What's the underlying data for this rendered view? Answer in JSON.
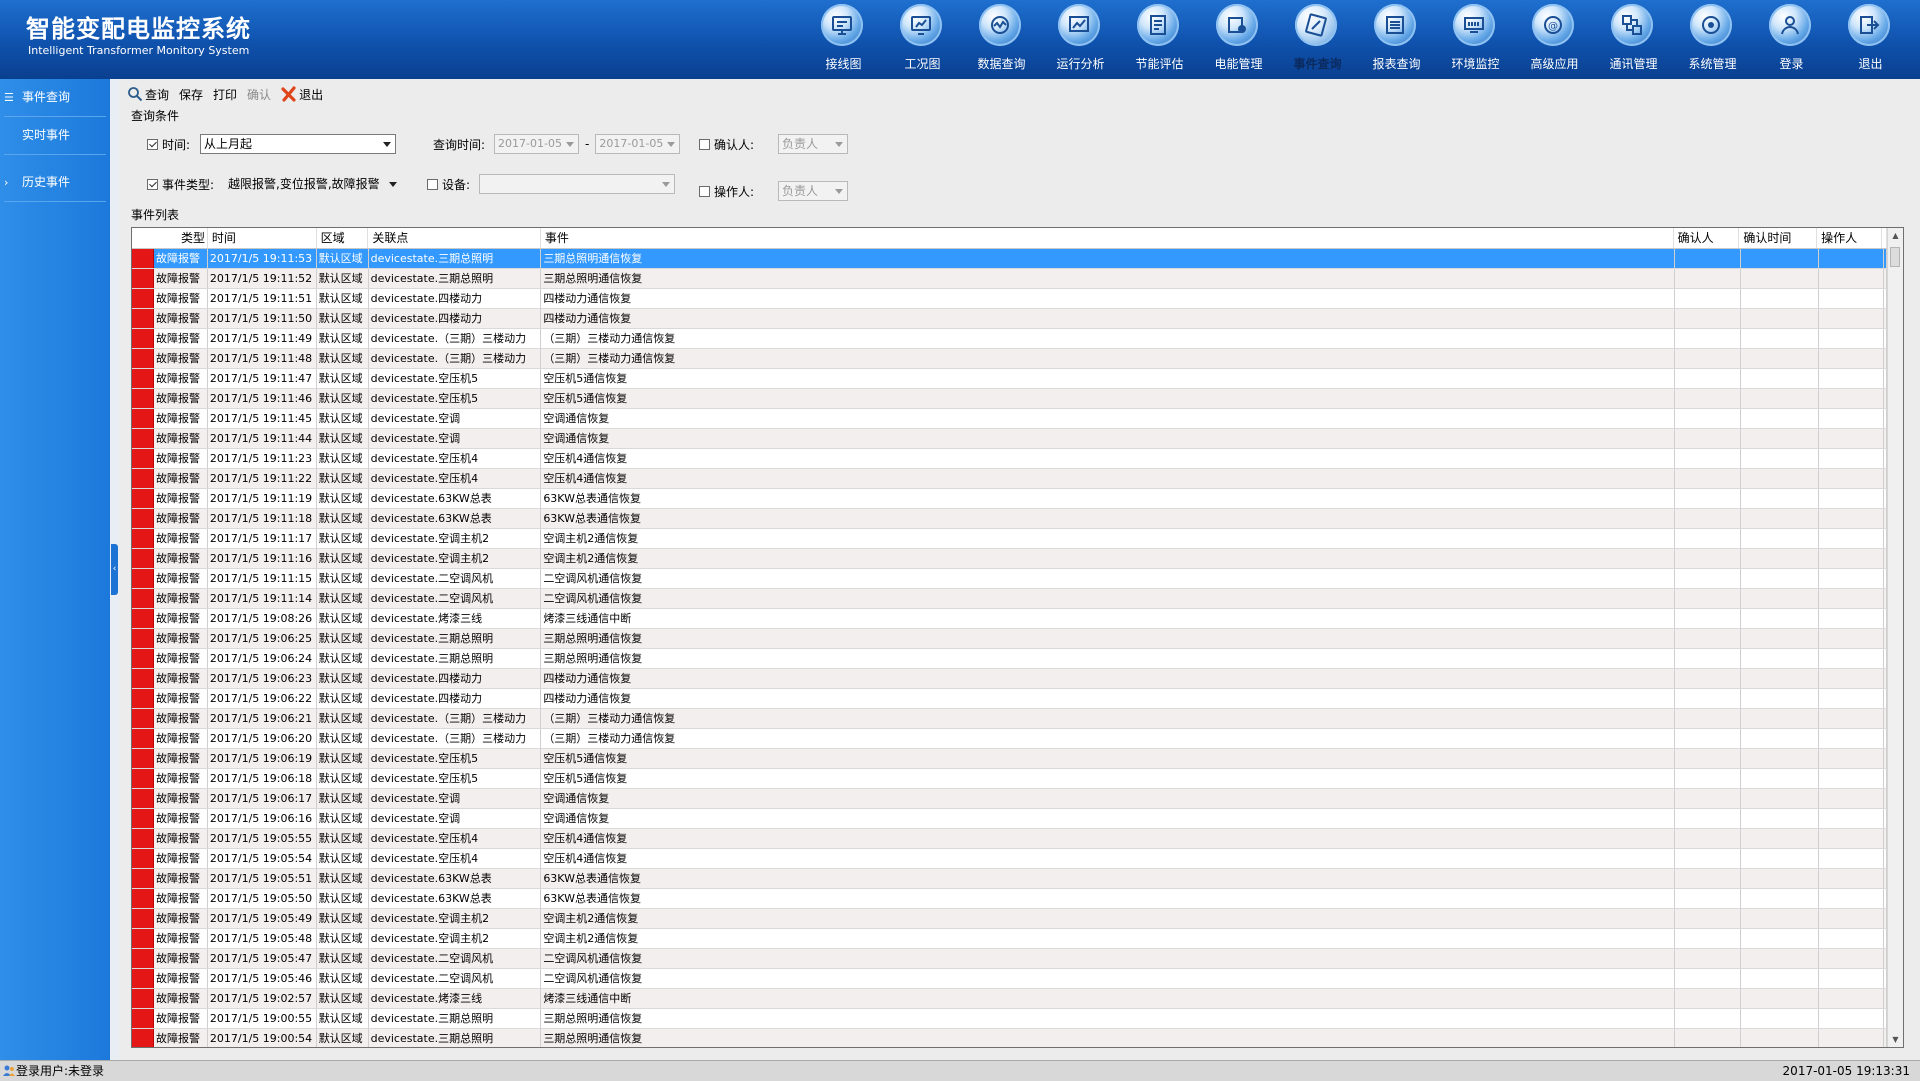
{
  "app": {
    "title": "智能变配电监控系统",
    "subtitle": "Intelligent Transformer Monitory System"
  },
  "nav": [
    {
      "label": "接线图",
      "icon": "wiring-diagram-icon"
    },
    {
      "label": "工况图",
      "icon": "monitor-screen-icon"
    },
    {
      "label": "数据查询",
      "icon": "data-query-icon"
    },
    {
      "label": "运行分析",
      "icon": "analysis-chart-icon"
    },
    {
      "label": "节能评估",
      "icon": "energy-assessment-icon"
    },
    {
      "label": "电能管理",
      "icon": "power-management-icon"
    },
    {
      "label": "事件查询",
      "icon": "event-query-icon",
      "active": true
    },
    {
      "label": "报表查询",
      "icon": "report-icon"
    },
    {
      "label": "环境监控",
      "icon": "environment-monitor-icon"
    },
    {
      "label": "高级应用",
      "icon": "advanced-app-icon"
    },
    {
      "label": "通讯管理",
      "icon": "communication-icon"
    },
    {
      "label": "系统管理",
      "icon": "system-settings-icon"
    },
    {
      "label": "登录",
      "icon": "user-login-icon"
    },
    {
      "label": "退出",
      "icon": "exit-icon"
    }
  ],
  "sidebar": {
    "items": [
      {
        "label": "事件查询",
        "mark": "☰"
      },
      {
        "label": "实时事件",
        "mark": ""
      },
      {
        "label": "历史事件",
        "mark": "›"
      }
    ]
  },
  "toolbar": {
    "query": "查询",
    "save": "保存",
    "print": "打印",
    "confirm": "确认",
    "exit": "退出"
  },
  "query": {
    "section_title": "查询条件",
    "time_label": "时间:",
    "time_value": "从上月起",
    "query_time_label": "查询时间:",
    "date_from": "2017-01-05",
    "date_sep": "-",
    "date_to": "2017-01-05",
    "confirmer_label": "确认人:",
    "confirmer_value": "负责人",
    "event_type_label": "事件类型:",
    "event_type_value": "越限报警,变位报警,故障报警",
    "device_label": "设备:",
    "device_value": "",
    "operator_label": "操作人:",
    "operator_value": "负责人"
  },
  "table": {
    "section_title": "事件列表",
    "columns": [
      "类型",
      "时间",
      "区域",
      "关联点",
      "事件",
      "确认人",
      "确认时间",
      "操作人"
    ],
    "rows": [
      [
        "故障报警",
        "2017/1/5 19:11:53",
        "默认区域",
        "devicestate.三期总照明",
        "三期总照明通信恢复"
      ],
      [
        "故障报警",
        "2017/1/5 19:11:52",
        "默认区域",
        "devicestate.三期总照明",
        "三期总照明通信恢复"
      ],
      [
        "故障报警",
        "2017/1/5 19:11:51",
        "默认区域",
        "devicestate.四楼动力",
        "四楼动力通信恢复"
      ],
      [
        "故障报警",
        "2017/1/5 19:11:50",
        "默认区域",
        "devicestate.四楼动力",
        "四楼动力通信恢复"
      ],
      [
        "故障报警",
        "2017/1/5 19:11:49",
        "默认区域",
        "devicestate.（三期）三楼动力",
        "（三期）三楼动力通信恢复"
      ],
      [
        "故障报警",
        "2017/1/5 19:11:48",
        "默认区域",
        "devicestate.（三期）三楼动力",
        "（三期）三楼动力通信恢复"
      ],
      [
        "故障报警",
        "2017/1/5 19:11:47",
        "默认区域",
        "devicestate.空压机5",
        "空压机5通信恢复"
      ],
      [
        "故障报警",
        "2017/1/5 19:11:46",
        "默认区域",
        "devicestate.空压机5",
        "空压机5通信恢复"
      ],
      [
        "故障报警",
        "2017/1/5 19:11:45",
        "默认区域",
        "devicestate.空调",
        "空调通信恢复"
      ],
      [
        "故障报警",
        "2017/1/5 19:11:44",
        "默认区域",
        "devicestate.空调",
        "空调通信恢复"
      ],
      [
        "故障报警",
        "2017/1/5 19:11:23",
        "默认区域",
        "devicestate.空压机4",
        "空压机4通信恢复"
      ],
      [
        "故障报警",
        "2017/1/5 19:11:22",
        "默认区域",
        "devicestate.空压机4",
        "空压机4通信恢复"
      ],
      [
        "故障报警",
        "2017/1/5 19:11:19",
        "默认区域",
        "devicestate.63KW总表",
        "63KW总表通信恢复"
      ],
      [
        "故障报警",
        "2017/1/5 19:11:18",
        "默认区域",
        "devicestate.63KW总表",
        "63KW总表通信恢复"
      ],
      [
        "故障报警",
        "2017/1/5 19:11:17",
        "默认区域",
        "devicestate.空调主机2",
        "空调主机2通信恢复"
      ],
      [
        "故障报警",
        "2017/1/5 19:11:16",
        "默认区域",
        "devicestate.空调主机2",
        "空调主机2通信恢复"
      ],
      [
        "故障报警",
        "2017/1/5 19:11:15",
        "默认区域",
        "devicestate.二空调风机",
        "二空调风机通信恢复"
      ],
      [
        "故障报警",
        "2017/1/5 19:11:14",
        "默认区域",
        "devicestate.二空调风机",
        "二空调风机通信恢复"
      ],
      [
        "故障报警",
        "2017/1/5 19:08:26",
        "默认区域",
        "devicestate.烤漆三线",
        "烤漆三线通信中断"
      ],
      [
        "故障报警",
        "2017/1/5 19:06:25",
        "默认区域",
        "devicestate.三期总照明",
        "三期总照明通信恢复"
      ],
      [
        "故障报警",
        "2017/1/5 19:06:24",
        "默认区域",
        "devicestate.三期总照明",
        "三期总照明通信恢复"
      ],
      [
        "故障报警",
        "2017/1/5 19:06:23",
        "默认区域",
        "devicestate.四楼动力",
        "四楼动力通信恢复"
      ],
      [
        "故障报警",
        "2017/1/5 19:06:22",
        "默认区域",
        "devicestate.四楼动力",
        "四楼动力通信恢复"
      ],
      [
        "故障报警",
        "2017/1/5 19:06:21",
        "默认区域",
        "devicestate.（三期）三楼动力",
        "（三期）三楼动力通信恢复"
      ],
      [
        "故障报警",
        "2017/1/5 19:06:20",
        "默认区域",
        "devicestate.（三期）三楼动力",
        "（三期）三楼动力通信恢复"
      ],
      [
        "故障报警",
        "2017/1/5 19:06:19",
        "默认区域",
        "devicestate.空压机5",
        "空压机5通信恢复"
      ],
      [
        "故障报警",
        "2017/1/5 19:06:18",
        "默认区域",
        "devicestate.空压机5",
        "空压机5通信恢复"
      ],
      [
        "故障报警",
        "2017/1/5 19:06:17",
        "默认区域",
        "devicestate.空调",
        "空调通信恢复"
      ],
      [
        "故障报警",
        "2017/1/5 19:06:16",
        "默认区域",
        "devicestate.空调",
        "空调通信恢复"
      ],
      [
        "故障报警",
        "2017/1/5 19:05:55",
        "默认区域",
        "devicestate.空压机4",
        "空压机4通信恢复"
      ],
      [
        "故障报警",
        "2017/1/5 19:05:54",
        "默认区域",
        "devicestate.空压机4",
        "空压机4通信恢复"
      ],
      [
        "故障报警",
        "2017/1/5 19:05:51",
        "默认区域",
        "devicestate.63KW总表",
        "63KW总表通信恢复"
      ],
      [
        "故障报警",
        "2017/1/5 19:05:50",
        "默认区域",
        "devicestate.63KW总表",
        "63KW总表通信恢复"
      ],
      [
        "故障报警",
        "2017/1/5 19:05:49",
        "默认区域",
        "devicestate.空调主机2",
        "空调主机2通信恢复"
      ],
      [
        "故障报警",
        "2017/1/5 19:05:48",
        "默认区域",
        "devicestate.空调主机2",
        "空调主机2通信恢复"
      ],
      [
        "故障报警",
        "2017/1/5 19:05:47",
        "默认区域",
        "devicestate.二空调风机",
        "二空调风机通信恢复"
      ],
      [
        "故障报警",
        "2017/1/5 19:05:46",
        "默认区域",
        "devicestate.二空调风机",
        "二空调风机通信恢复"
      ],
      [
        "故障报警",
        "2017/1/5 19:02:57",
        "默认区域",
        "devicestate.烤漆三线",
        "烤漆三线通信中断"
      ],
      [
        "故障报警",
        "2017/1/5 19:00:55",
        "默认区域",
        "devicestate.三期总照明",
        "三期总照明通信恢复"
      ],
      [
        "故障报警",
        "2017/1/5 19:00:54",
        "默认区域",
        "devicestate.三期总照明",
        "三期总照明通信恢复"
      ]
    ],
    "selected_row": 0
  },
  "status": {
    "user": "登录用户:未登录",
    "clock": "2017-01-05 19:13:31"
  },
  "colors": {
    "header": "#0f52ad",
    "sidebar": "#2381df",
    "alarm_marker": "#e51616",
    "selected_row": "#3399ff"
  }
}
